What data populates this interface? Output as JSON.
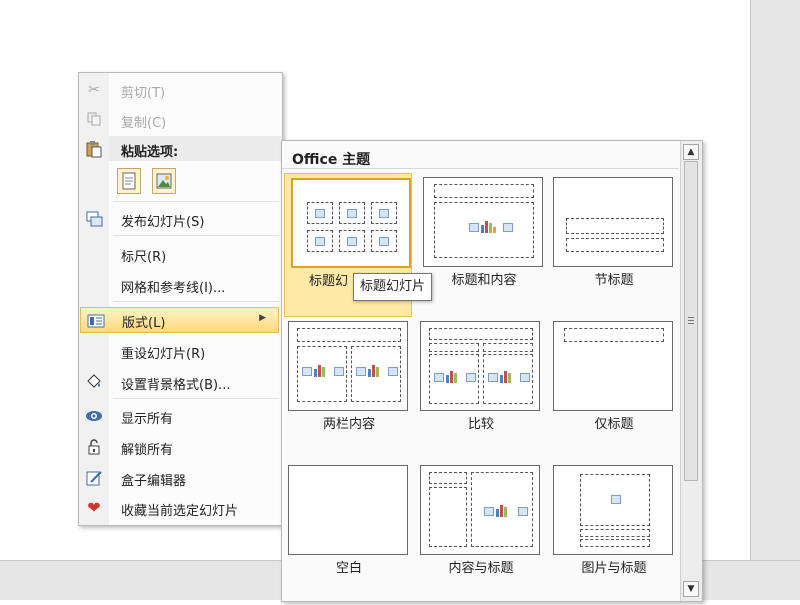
{
  "context_menu": {
    "cut": "剪切(T)",
    "copy": "复制(C)",
    "paste_header": "粘贴选项:",
    "publish": "发布幻灯片(S)",
    "ruler": "标尺(R)",
    "grid": "网格和参考线(I)...",
    "layout": "版式(L)",
    "reset": "重设幻灯片(R)",
    "background": "设置背景格式(B)...",
    "show_all": "显示所有",
    "unlock_all": "解锁所有",
    "box_editor": "盒子编辑器",
    "favorite": "收藏当前选定幻灯片",
    "icon_colors": {
      "accent": "#3c6ea5",
      "heart": "#d0342c"
    }
  },
  "gallery": {
    "title": "Office 主题",
    "layouts": [
      "标题幻灯片",
      "标题和内容",
      "节标题",
      "两栏内容",
      "比较",
      "仅标题",
      "空白",
      "内容与标题",
      "图片与标题"
    ],
    "selected_caption": "标题幻"
  },
  "tooltip": "标题幻灯片",
  "colors": {
    "highlight": "#ffd97a",
    "selected_tile": "#ffe9a6"
  }
}
